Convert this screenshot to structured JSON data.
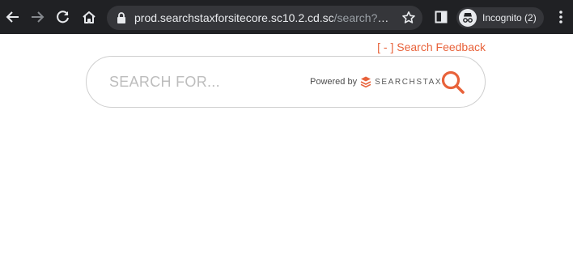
{
  "browser": {
    "url_host": "prod.searchstaxforsitecore.sc10.2.cd.sc",
    "url_path": "/search?sea...",
    "profile_label": "Incognito (2)",
    "icons": {
      "back": "arrow-left-icon",
      "forward": "arrow-right-icon",
      "reload": "reload-icon",
      "home": "home-icon",
      "lock": "lock-icon",
      "bookmark": "star-icon",
      "sidepanel": "side-panel-icon",
      "incognito": "incognito-icon",
      "menu": "kebab-menu-icon"
    }
  },
  "page": {
    "feedback_link": "[ - ] Search Feedback",
    "search": {
      "placeholder": "SEARCH FOR...",
      "powered_by": "Powered by",
      "brand": "SEARCHSTAX"
    },
    "colors": {
      "accent": "#e8623a",
      "toolbar": "#202124",
      "omnibox": "#35363a"
    }
  }
}
